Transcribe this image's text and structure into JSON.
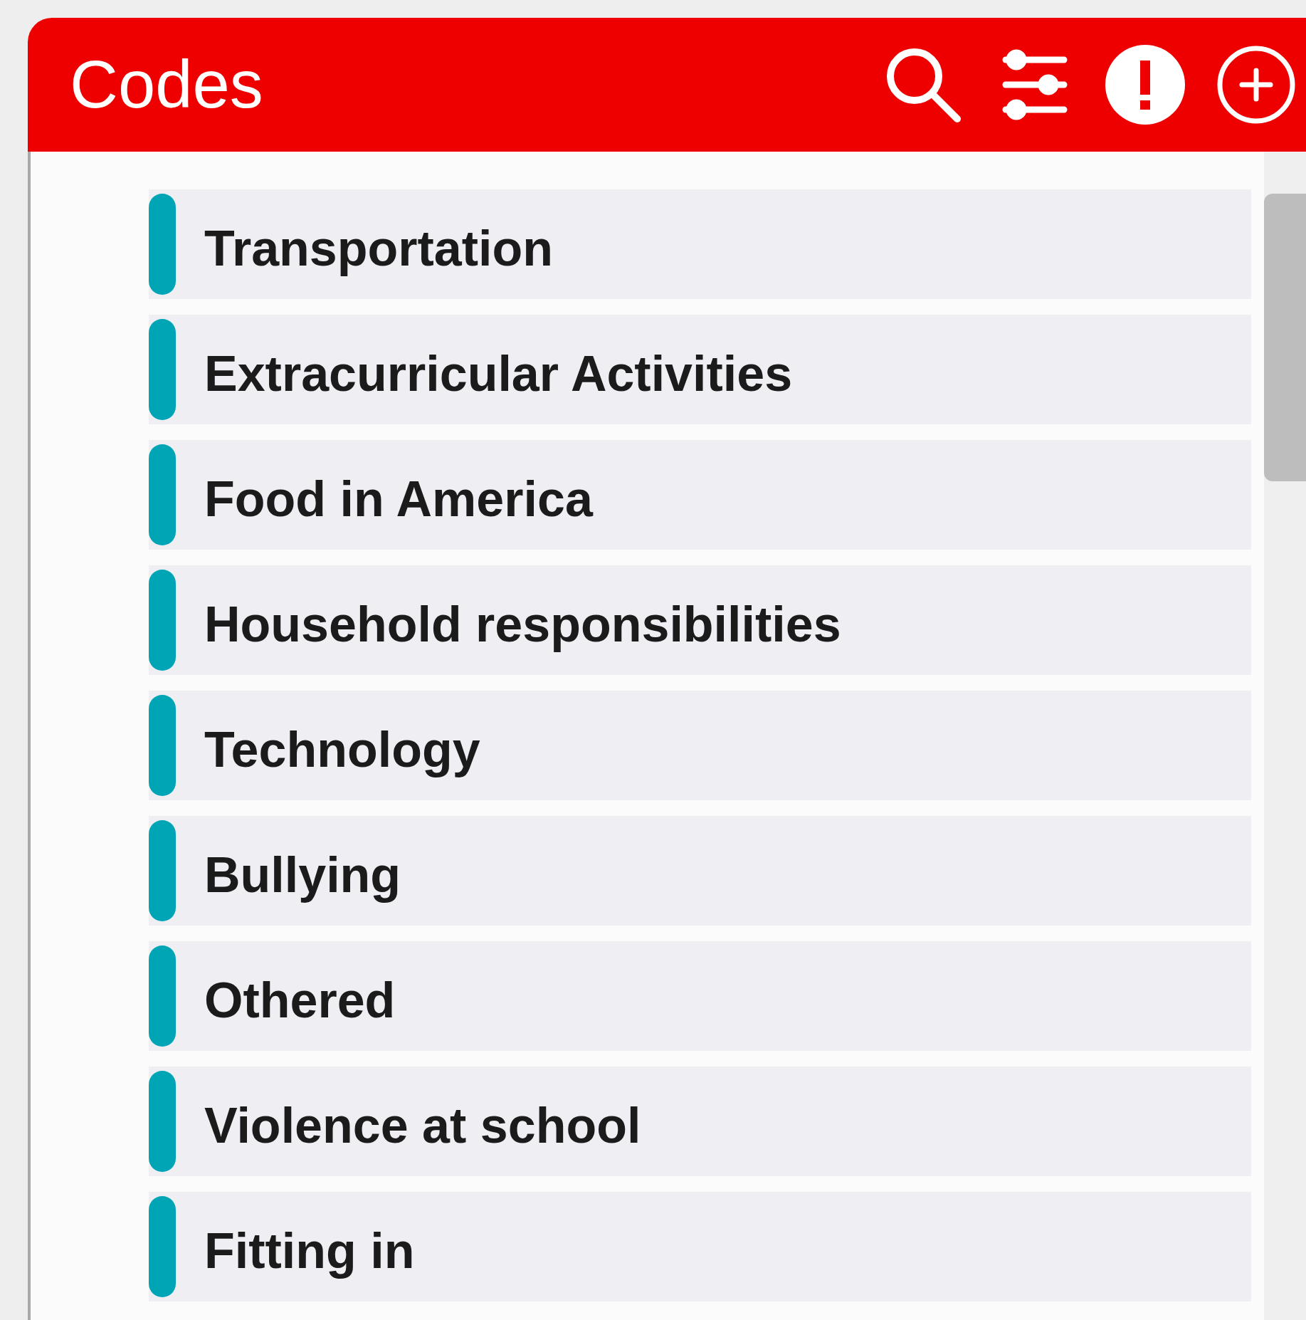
{
  "header": {
    "title": "Codes"
  },
  "codes": [
    {
      "label": "Transportation"
    },
    {
      "label": "Extracurricular Activities"
    },
    {
      "label": "Food in America"
    },
    {
      "label": "Household responsibilities"
    },
    {
      "label": "Technology"
    },
    {
      "label": "Bullying"
    },
    {
      "label": "Othered"
    },
    {
      "label": "Violence at school"
    },
    {
      "label": "Fitting in"
    }
  ]
}
